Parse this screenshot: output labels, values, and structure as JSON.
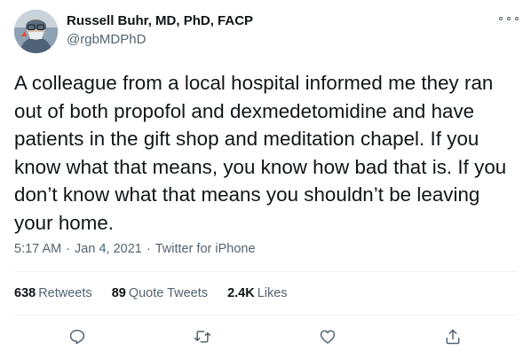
{
  "author": {
    "display_name": "Russell Buhr, MD, PhD, FACP",
    "handle": "@rgbMDPhD"
  },
  "tweet": {
    "text": "A colleague from a local hospital informed me they ran out of both propofol and dexmedetomidine and have patients in the gift shop and meditation chapel. If you know what that means, you know how bad that is. If you don’t know what that means you shouldn’t be leaving your home.",
    "time": "5:17 AM",
    "date": "Jan 4, 2021",
    "source": "Twitter for iPhone",
    "separator": "·"
  },
  "stats": {
    "retweets_count": "638",
    "retweets_label": "Retweets",
    "quote_count": "89",
    "quote_label": "Quote Tweets",
    "likes_count": "2.4K",
    "likes_label": "Likes"
  },
  "icons": {
    "more": "more-horizontal-icon",
    "reply": "reply-icon",
    "retweet": "retweet-icon",
    "like": "heart-icon",
    "share": "share-icon"
  },
  "colors": {
    "text_primary": "#0f1419",
    "text_secondary": "#536471",
    "divider": "#eff3f4"
  }
}
